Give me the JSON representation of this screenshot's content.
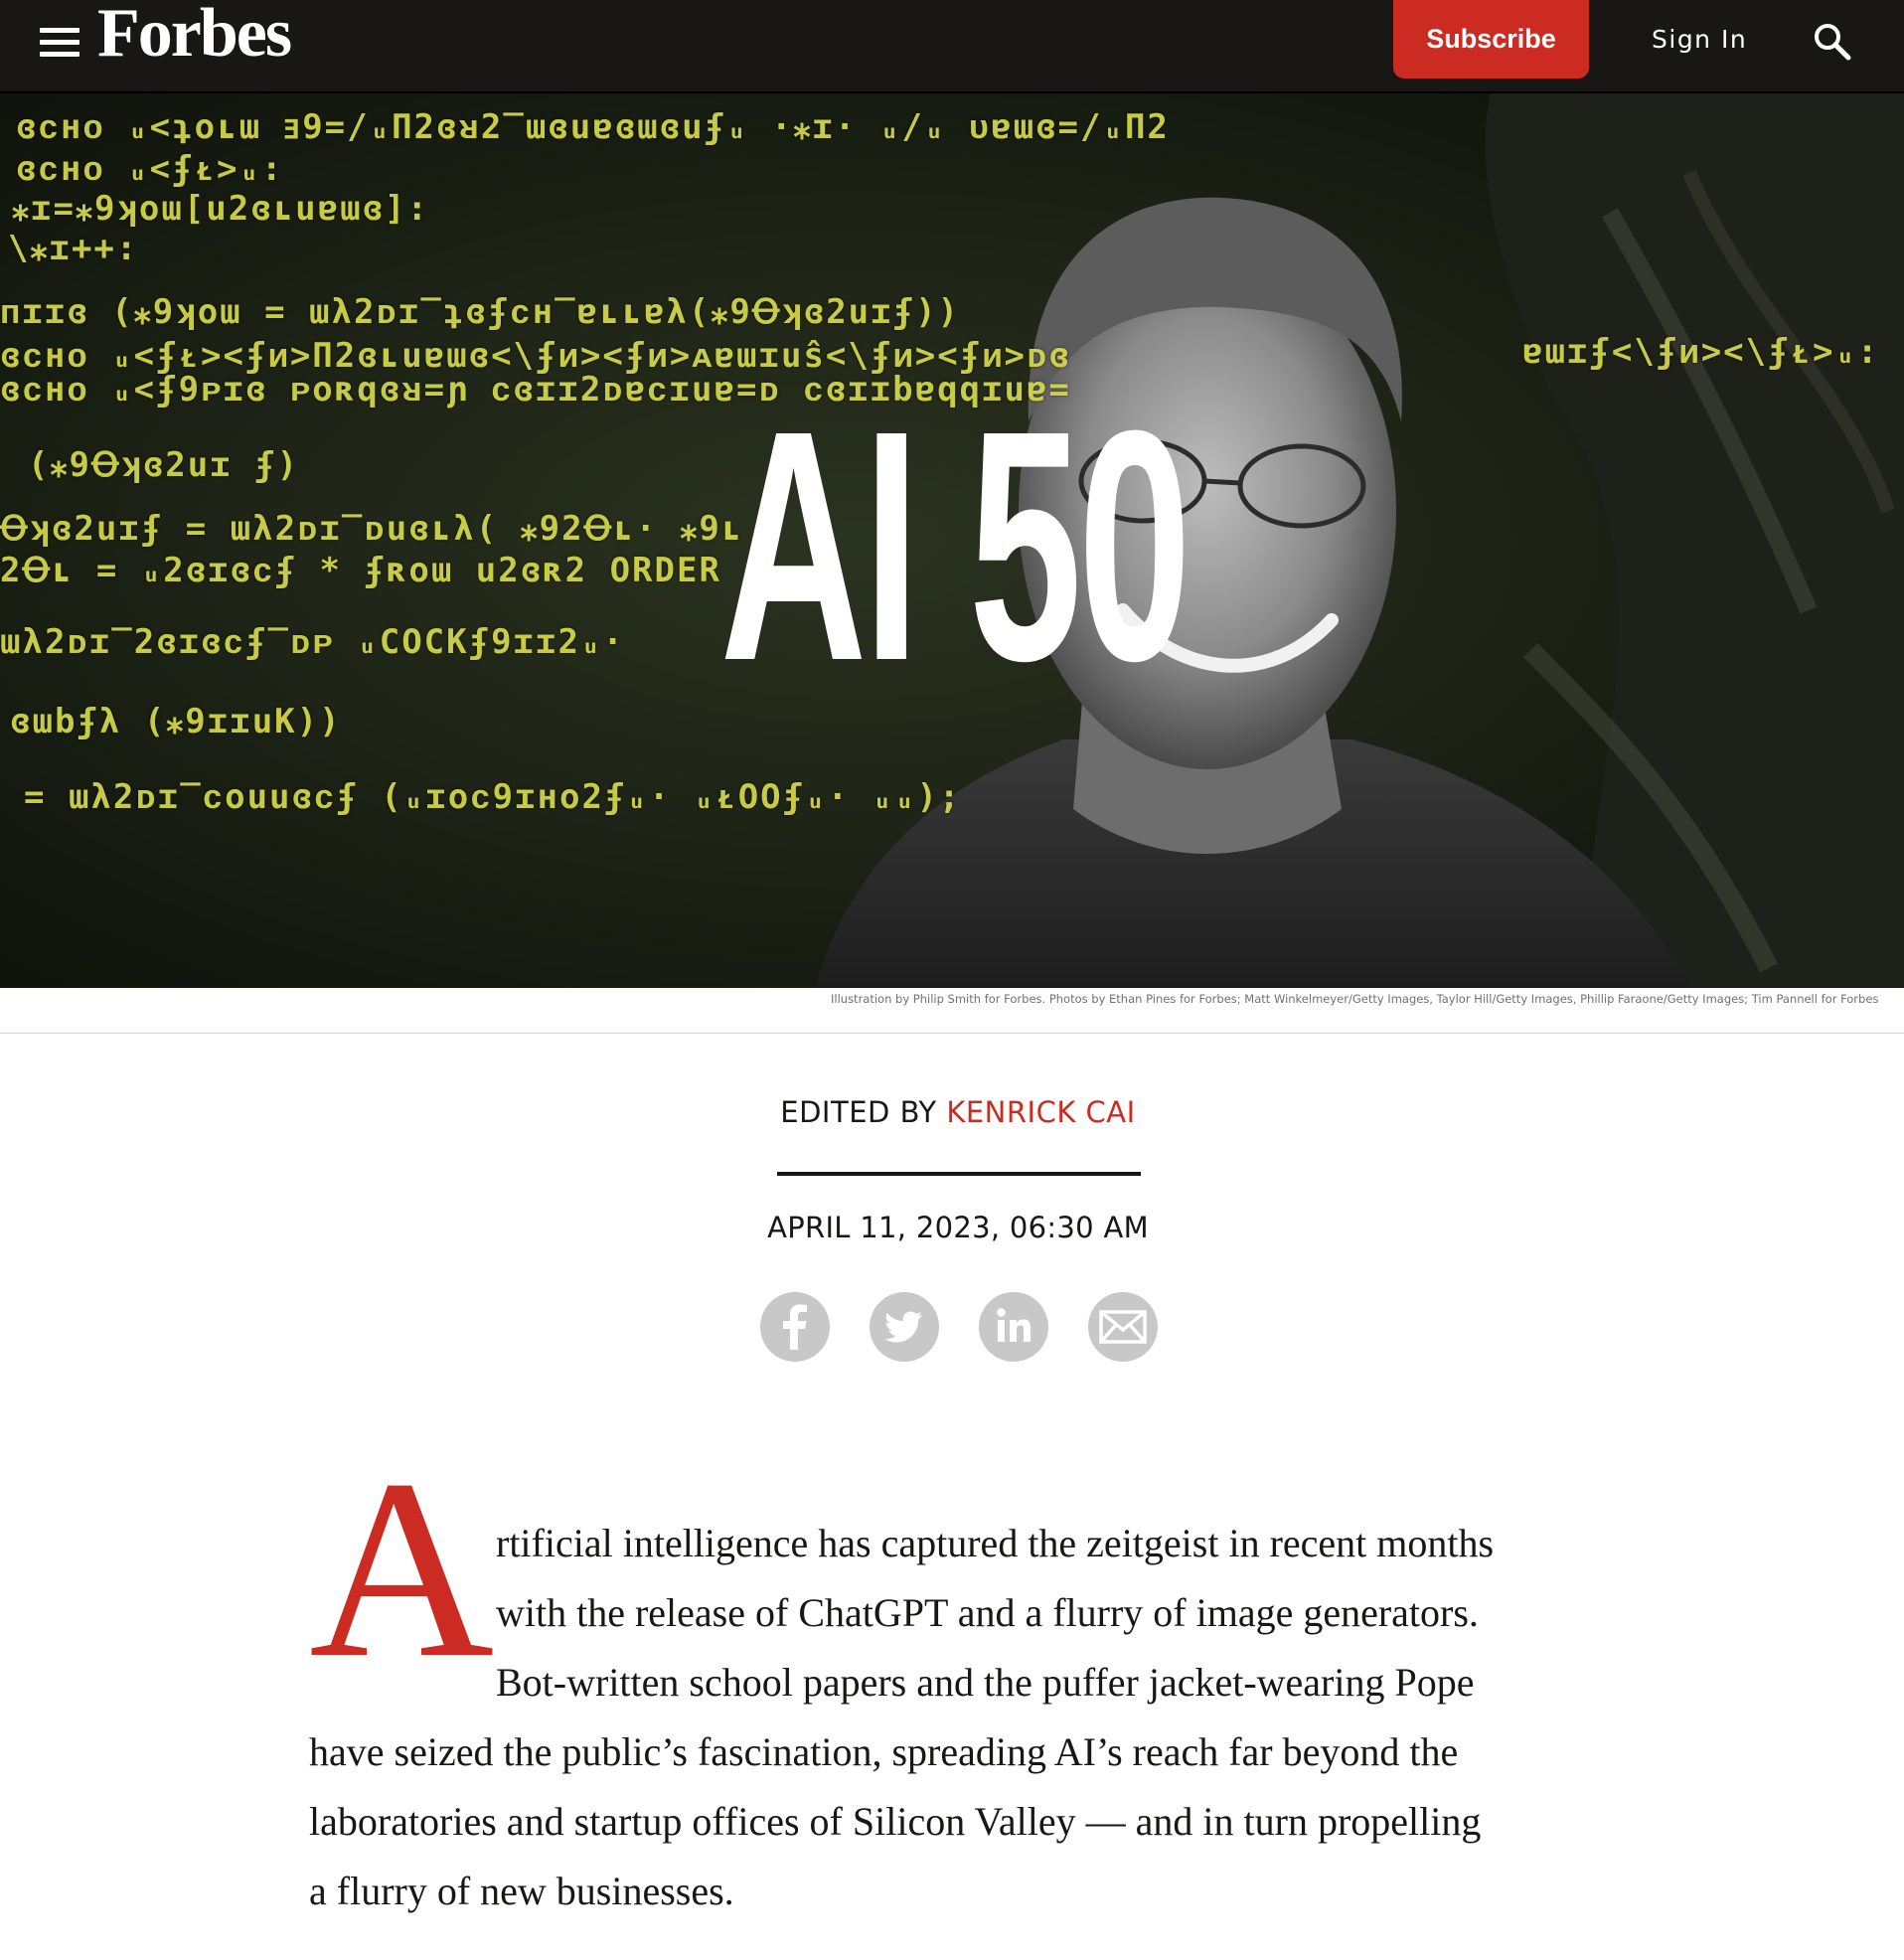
{
  "nav": {
    "brand": "Forbes",
    "subscribe_label": "Subscribe",
    "signin_label": "Sign In",
    "menu_icon": "hamburger-menu-icon",
    "search_icon": "search-icon"
  },
  "hero": {
    "title": "AI 50",
    "code_lines": [
      "ɞᴄнᴏ ᵤ<ʇoʟɯ ⱻ9=/ᵤП2ɞᴚ2‾ɯɞuɐɞɯɞuʄᵤ ·⁎ɪ· ᵤ/ᵤ ᴜɐɯɞ=/ᵤП2",
      "ɞᴄнᴏ ᵤ<ʄᴌ>ᵤ:",
      "⁎ɪ=⁎9ʞoɯ[u2ɞʟuɐɯɞ]:",
      "\\⁎ɪ++:",
      "ᴨɪɪɞ (⁎9ʞoɯ = ɯλ2ᴅɪ‾ʇɞʄᴄн‾ɐʟʟɐλ(⁎9Ꝋʞɞ2uɪʄ))",
      "ɞᴄнᴏ ᵤ<ʄᴌ><ʄᴎ>П2ɞʟuɐɯɞ<\\ʄᴎ><ʄᴎ>ᴀɐɯɪuŝ<\\ʄᴎ><ʄᴎ>ᴅɞ",
      "ɞᴄнᴏ ᵤ<ʄ9ᴘɪɞ ᴘoʀqɞᴚ=ɲ ᴄɞɪɪ2ᴅɐᴄɪuɐ=ᴅ ᴄɞɪɪbɐqqɪuɐ=",
      "(⁎9Ꝋʞɞ2uɪ ʄ)",
      "Ꝋʞɞ2uɪʄ = ɯλ2ᴅɪ‾ᴅuɞʟλ( ⁎92Ꝋʟ· ⁎9ʟ",
      "2Ꝋʟ = ᵤ2ɞɪɞᴄʄ * ʄʀoɯ u2ɞʀ2 ORDER",
      "ɯλ2ᴅɪ‾2ɞɪɞᴄʄ‾ᴅᴘ ᵤCOCKʄ9ɪɪ2ᵤ·",
      "ɞɯbʄλ (⁎9ɪɪuK))",
      "= ɯλ2ᴅɪ‾ᴄouuɞᴄʄ (ᵤɪoᴄ9ɪнo2ʄᵤ· ᵤᴌOOʄᵤ· ᵤᵤ);",
      "ɐɯɪʄ<\\ʄᴎ><\\ʄᴌ>ᵤ:"
    ]
  },
  "credit": "Illustration by Philip Smith for Forbes. Photos by Ethan Pines for Forbes; Matt Winkelmeyer/Getty Images, Taylor Hill/Getty Images, Phillip Faraone/Getty Images; Tim Pannell for Forbes",
  "byline": {
    "prefix": "EDITED BY",
    "author": "KENRICK CAI",
    "date": "APRIL 11, 2023, 06:30 AM"
  },
  "share": {
    "icons": [
      "facebook-icon",
      "twitter-icon",
      "linkedin-icon",
      "email-icon"
    ]
  },
  "article": {
    "drop_cap": "A",
    "lines": [
      "rtificial intelligence has captured the zeitgeist in recent months",
      "with the release of ChatGPT and a flurry of image generators.",
      "Bot-written school papers and the puffer jacket-wearing Pope",
      "have seized the public’s fascination, spreading AI’s reach far beyond the",
      "laboratories and startup offices of Silicon Valley — and in turn propelling",
      "a flurry of new businesses."
    ]
  },
  "colors": {
    "brand_red": "#cc2b21",
    "nav_bg": "#181716",
    "code_yellow": "#d6d94a",
    "icon_gray": "#c8c8c8"
  }
}
